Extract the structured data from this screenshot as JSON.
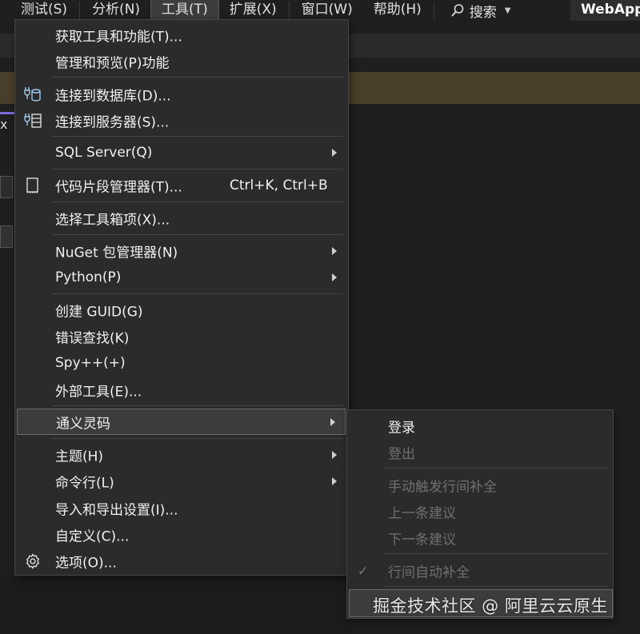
{
  "menubar": {
    "items": [
      "测试(S)",
      "分析(N)",
      "工具(T)",
      "扩展(X)",
      "窗口(W)",
      "帮助(H)"
    ],
    "active_index": 2,
    "search_label": "搜索",
    "project_title": "WebApp"
  },
  "bg": {
    "close_glyph": "x"
  },
  "tools_menu": {
    "items": {
      "get_tools": "获取工具和功能(T)...",
      "manage_preview": "管理和预览(P)功能",
      "connect_db": "连接到数据库(D)...",
      "connect_server": "连接到服务器(S)...",
      "sql_server": "SQL Server(Q)",
      "snippets": "代码片段管理器(T)...",
      "snippets_shortcut": "Ctrl+K, Ctrl+B",
      "choose_toolbox": "选择工具箱项(X)...",
      "nuget": "NuGet 包管理器(N)",
      "python": "Python(P)",
      "create_guid": "创建 GUID(G)",
      "error_lookup": "错误查找(K)",
      "spy": "Spy++(+)",
      "external_tools": "外部工具(E)...",
      "tongyi": "通义灵码",
      "theme": "主题(H)",
      "command_line": "命令行(L)",
      "import_export": "导入和导出设置(I)...",
      "customize": "自定义(C)...",
      "options": "选项(O)..."
    }
  },
  "tongyi_submenu": {
    "items": {
      "login": "登录",
      "logout": "登出",
      "manual_trigger": "手动触发行间补全",
      "prev_suggestion": "上一条建议",
      "next_suggestion": "下一条建议",
      "auto_complete": "行间自动补全",
      "check_glyph": "✓"
    }
  },
  "watermark": "掘金技术社区 @ 阿里云云原生",
  "colors": {
    "menu_bg": "#2b2b2b",
    "highlight": "#3c3c3c",
    "disabled_text": "#6f6f6f",
    "info_bar": "#4a3f2a"
  }
}
